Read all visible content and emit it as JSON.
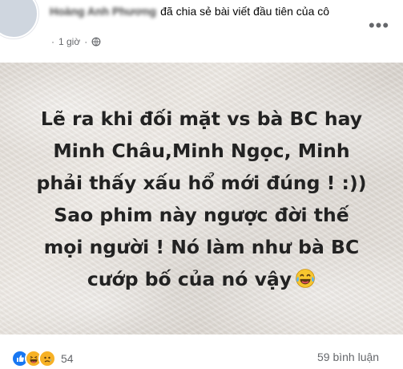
{
  "post": {
    "author_name": "Hoàng Anh Phương",
    "action_text": "đã chia sẻ bài viết đầu tiên của cô",
    "time": "1 giờ",
    "separator": "·",
    "more_icon": "more-horizontal-icon",
    "privacy_icon": "globe-icon",
    "image_text": [
      "Lẽ ra khi đối mặt vs bà BC hay",
      "Minh Châu,Minh Ngọc, Minh",
      "phải thấy xấu hổ mới đúng ! :))",
      "Sao phim này ngược đời thế",
      "mọi người ! Nó làm như bà BC",
      "cướp bố của nó vậy"
    ],
    "caption_emoji": "laughing-tears-emoji",
    "reactions": {
      "types": [
        "like",
        "haha",
        "sad"
      ],
      "count": "54"
    },
    "comments_text": "59 bình luận"
  },
  "colors": {
    "text": "#050505",
    "meta": "#65676b",
    "like_blue": "#1877f2",
    "reaction_yellow": "#f7b125"
  }
}
